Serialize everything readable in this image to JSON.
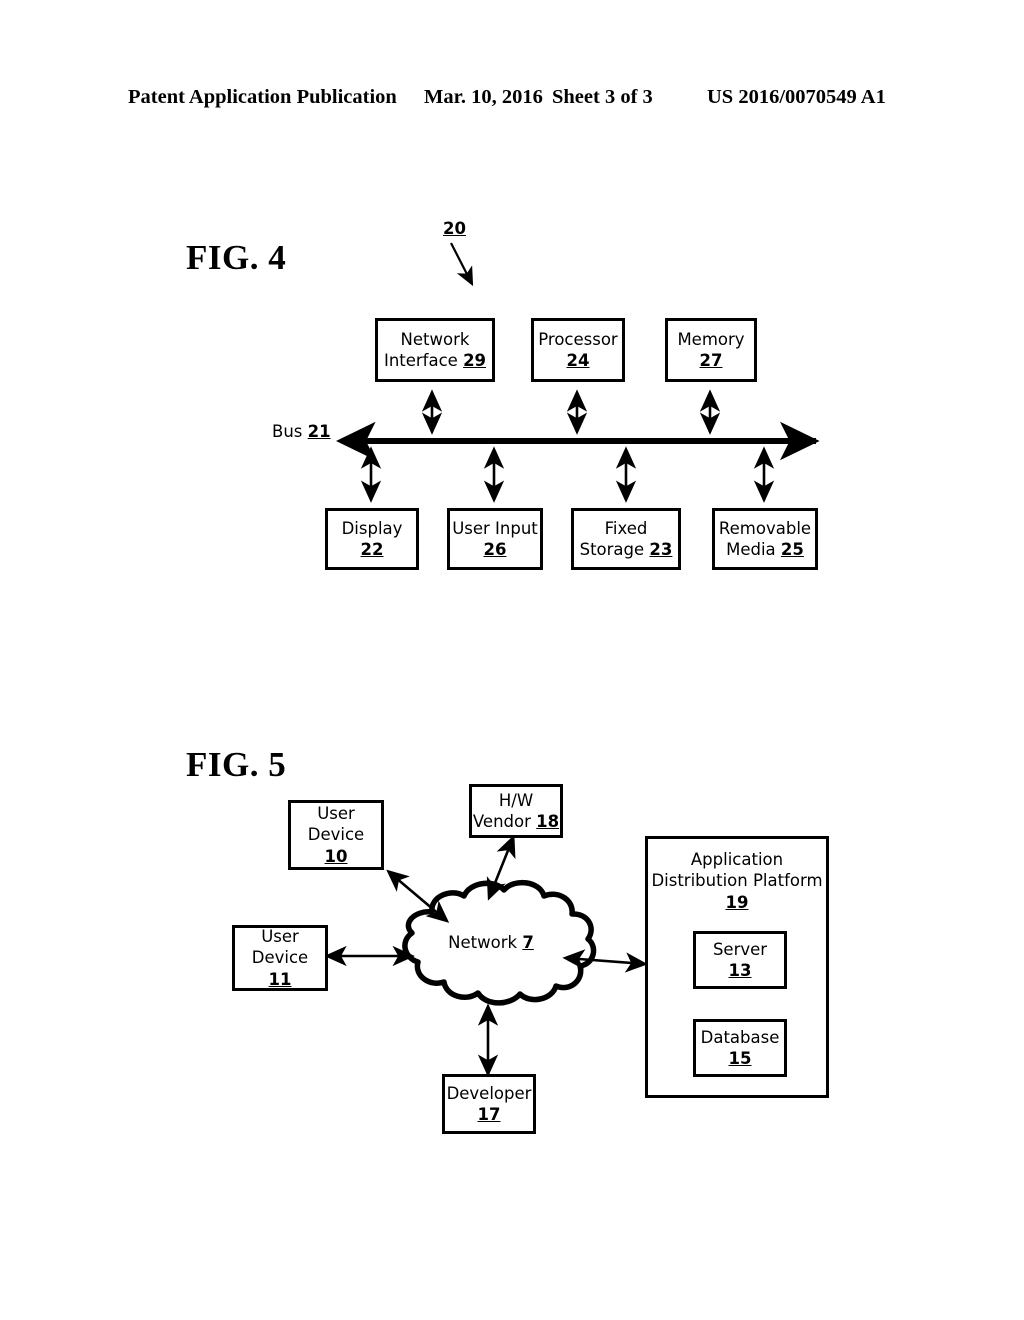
{
  "header": {
    "publication": "Patent Application Publication",
    "date": "Mar. 10, 2016",
    "sheet": "Sheet 3 of 3",
    "patent_number": "US 2016/0070549 A1"
  },
  "figures": [
    {
      "label": "FIG. 4",
      "system_ref": "20",
      "bus": {
        "label": "Bus",
        "ref": "21"
      },
      "top_row": [
        {
          "name": "network-interface",
          "line1": "Network",
          "line2": "Interface",
          "ref": "29"
        },
        {
          "name": "processor",
          "line1": "Processor",
          "line2": "",
          "ref": "24"
        },
        {
          "name": "memory",
          "line1": "Memory",
          "line2": "",
          "ref": "27"
        }
      ],
      "bottom_row": [
        {
          "name": "display",
          "line1": "Display",
          "line2": "",
          "ref": "22"
        },
        {
          "name": "user-input",
          "line1": "User Input",
          "line2": "",
          "ref": "26"
        },
        {
          "name": "fixed-storage",
          "line1": "Fixed",
          "line2": "Storage",
          "ref": "23"
        },
        {
          "name": "removable-media",
          "line1": "Removable",
          "line2": "Media",
          "ref": "25"
        }
      ]
    },
    {
      "label": "FIG. 5",
      "network": {
        "line1": "Network",
        "ref": "7"
      },
      "nodes": [
        {
          "name": "user-device-10",
          "line1": "User",
          "line2": "Device",
          "ref": "10"
        },
        {
          "name": "user-device-11",
          "line1": "User",
          "line2": "Device",
          "ref": "11"
        },
        {
          "name": "hw-vendor-18",
          "line1": "H/W",
          "line2": "Vendor",
          "ref": "18"
        },
        {
          "name": "developer-17",
          "line1": "Developer",
          "line2": "",
          "ref": "17"
        }
      ],
      "platform": {
        "title_line1": "Application",
        "title_line2": "Distribution Platform",
        "ref": "19",
        "children": [
          {
            "name": "server-13",
            "line1": "Server",
            "ref": "13"
          },
          {
            "name": "database-15",
            "line1": "Database",
            "ref": "15"
          }
        ]
      }
    }
  ]
}
